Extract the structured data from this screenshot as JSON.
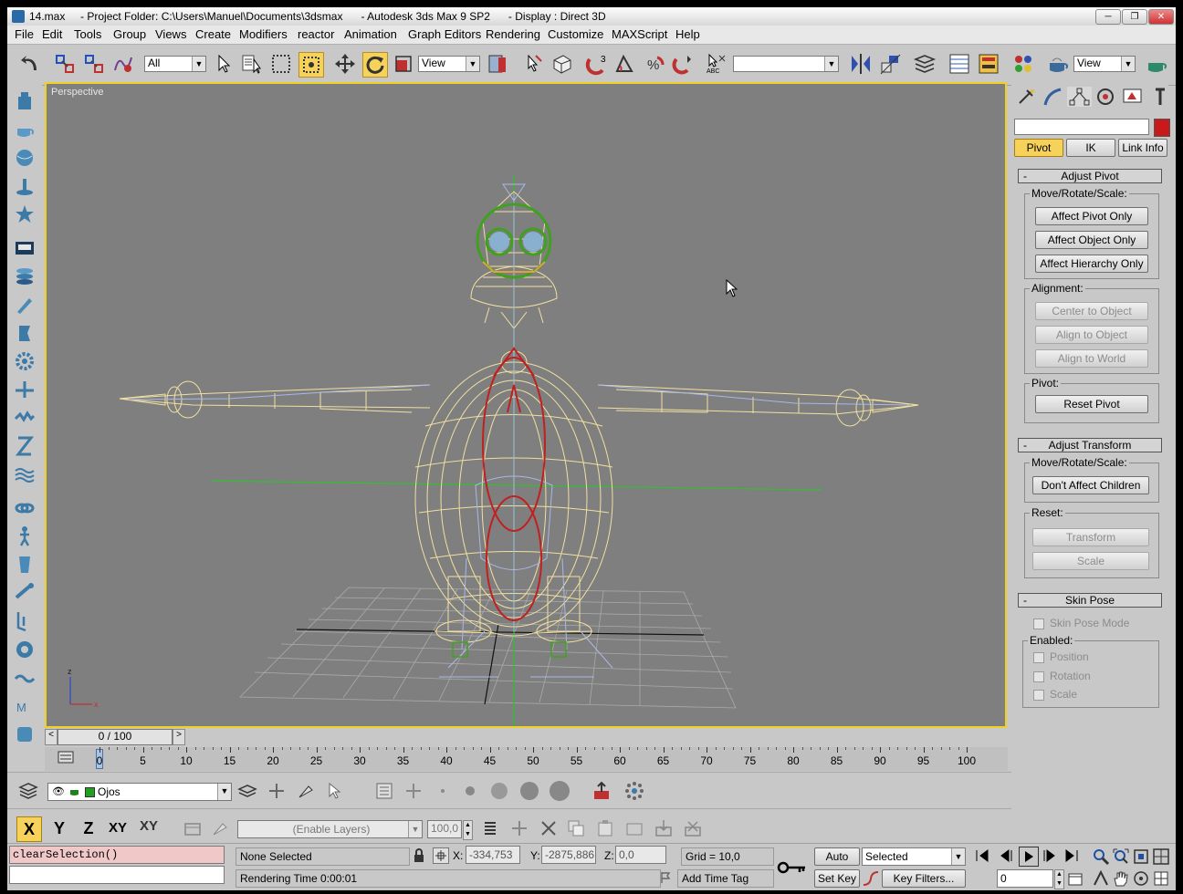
{
  "window": {
    "file_name": "14.max",
    "project_folder": "- Project Folder: C:\\Users\\Manuel\\Documents\\3dsmax",
    "app_name": "- Autodesk 3ds Max 9 SP2",
    "display": "- Display : Direct 3D",
    "minimize": "─",
    "maximize": "❐",
    "close": "✕"
  },
  "menubar": {
    "items": [
      "File",
      "Edit",
      "Tools",
      "Group",
      "Views",
      "Create",
      "Modifiers",
      "reactor",
      "Animation",
      "Graph Editors",
      "Rendering",
      "Customize",
      "MAXScript",
      "Help"
    ]
  },
  "toolbar": {
    "selection_filter": "All",
    "ref_coord_system": "View",
    "named_selection": "",
    "render_view": "View"
  },
  "viewport": {
    "label": "Perspective",
    "axis_x": "x",
    "axis_z": "z"
  },
  "command_panel": {
    "name_field": "",
    "color_swatch": "#c81a1a",
    "tabs": [
      "Pivot",
      "IK",
      "Link Info"
    ],
    "adjust_pivot": {
      "title": "Adjust Pivot",
      "minus": "-",
      "move_group": "Move/Rotate/Scale:",
      "affect_pivot_only": "Affect Pivot Only",
      "affect_object_only": "Affect Object Only",
      "affect_hierarchy_only": "Affect Hierarchy Only",
      "alignment_group": "Alignment:",
      "center_to_object": "Center to Object",
      "align_to_object": "Align to Object",
      "align_to_world": "Align to World",
      "pivot_group": "Pivot:",
      "reset_pivot": "Reset Pivot"
    },
    "adjust_transform": {
      "title": "Adjust Transform",
      "minus": "-",
      "move_group": "Move/Rotate/Scale:",
      "dont_affect_children": "Don't Affect Children",
      "reset_group": "Reset:",
      "transform": "Transform",
      "scale": "Scale"
    },
    "skin_pose": {
      "title": "Skin Pose",
      "minus": "-",
      "skin_pose_mode": "Skin Pose Mode",
      "enabled_group": "Enabled:",
      "position": "Position",
      "rotation": "Rotation",
      "scale": "Scale"
    }
  },
  "timeline": {
    "frame_counter": "0 / 100",
    "prev": "<",
    "next": ">",
    "ticks": [
      "0",
      "5",
      "10",
      "15",
      "20",
      "25",
      "30",
      "35",
      "40",
      "45",
      "50",
      "55",
      "60",
      "65",
      "70",
      "75",
      "80",
      "85",
      "90",
      "95",
      "100"
    ]
  },
  "layer_bar": {
    "current_layer": "Ojos"
  },
  "axis_bar": {
    "x": "X",
    "y": "Y",
    "z": "Z",
    "xy": "XY",
    "xy2": "XY",
    "enable_layers": "(Enable Layers)",
    "spinner_value": "100,0"
  },
  "status": {
    "maxscript": "clearSelection()",
    "selection": "None Selected",
    "render_time": "Rendering Time  0:00:01",
    "x_label": "X:",
    "x_value": "-334,753",
    "y_label": "Y:",
    "y_value": "-2875,886",
    "z_label": "Z:",
    "z_value": "0,0",
    "grid": "Grid = 10,0",
    "add_time_tag": "Add Time Tag",
    "auto_key": "Auto Key",
    "set_key": "Set Key",
    "key_mode": "Selected",
    "key_filters": "Key Filters...",
    "current_frame": "0"
  },
  "colors": {
    "viewport_bg": "#7f7f7f",
    "active_highlight": "#f6d25a",
    "wire_body": "#f0e0a0",
    "wire_bone": "#a8b8e8",
    "wire_red": "#c02020",
    "wire_green": "#40a020"
  }
}
